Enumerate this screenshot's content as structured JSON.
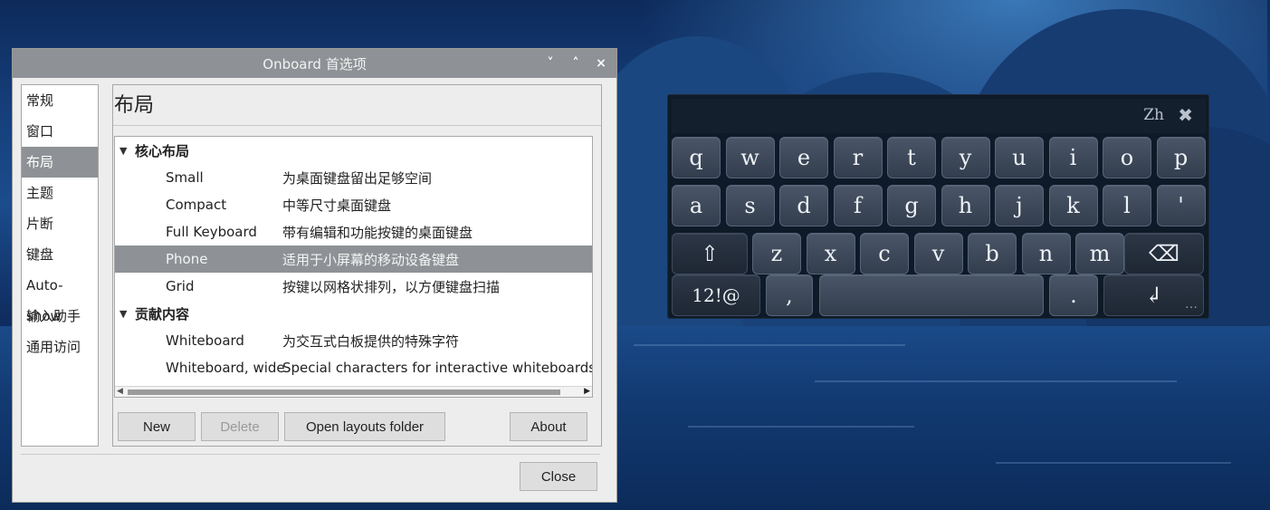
{
  "window": {
    "title": "Onboard 首选项",
    "controls": [
      "˅",
      "˄",
      "×"
    ]
  },
  "sidebar": {
    "items": [
      "常规",
      "窗口",
      "布局",
      "主题",
      "片断",
      "键盘",
      "Auto-show",
      "输入助手",
      "通用访问"
    ],
    "selected": "布局"
  },
  "content": {
    "heading": "布局",
    "groups": [
      {
        "label": "核心布局",
        "layouts": [
          {
            "name": "Small",
            "desc": "为桌面键盘留出足够空间"
          },
          {
            "name": "Compact",
            "desc": "中等尺寸桌面键盘"
          },
          {
            "name": "Full Keyboard",
            "desc": "带有编辑和功能按键的桌面键盘"
          },
          {
            "name": "Phone",
            "desc": "适用于小屏幕的移动设备键盘"
          },
          {
            "name": "Grid",
            "desc": "按键以网格状排列，以方便键盘扫描"
          }
        ]
      },
      {
        "label": "贡献内容",
        "layouts": [
          {
            "name": "Whiteboard",
            "desc": "为交互式白板提供的特殊字符"
          },
          {
            "name": "Whiteboard, wide",
            "desc": "Special characters for interactive whiteboards, wi"
          }
        ]
      }
    ],
    "selected_layout": "Phone",
    "buttons": {
      "new": "New",
      "delete": "Delete",
      "open_folder": "Open layouts folder",
      "about": "About"
    }
  },
  "footer": {
    "close": "Close"
  },
  "keyboard": {
    "lang": "Zh",
    "close_glyph": "✖",
    "row1": [
      "q",
      "w",
      "e",
      "r",
      "t",
      "y",
      "u",
      "i",
      "o",
      "p"
    ],
    "row2": [
      "a",
      "s",
      "d",
      "f",
      "g",
      "h",
      "j",
      "k",
      "l",
      "'"
    ],
    "row3": [
      "z",
      "x",
      "c",
      "v",
      "b",
      "n",
      "m"
    ],
    "shift": "⇧",
    "backspace": "⌫",
    "numbers": "12!@",
    "comma": ",",
    "period": ".",
    "enter": "↲",
    "more": "…"
  },
  "colors": {
    "selection": "#8e9296",
    "titlebar": "#8e9296",
    "keyboard_bg": "#0f1a28"
  }
}
